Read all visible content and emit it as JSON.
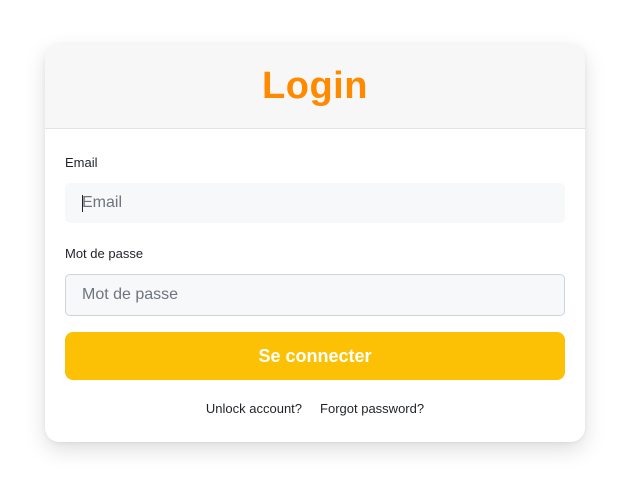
{
  "header": {
    "title": "Login"
  },
  "form": {
    "email_label": "Email",
    "email_placeholder": "Email",
    "email_value": "",
    "password_label": "Mot de passe",
    "password_placeholder": "Mot de passe",
    "password_value": "",
    "submit_label": "Se connecter"
  },
  "links": {
    "unlock": "Unlock account?",
    "forgot": "Forgot password?"
  },
  "colors": {
    "title": "#ff8a00",
    "button": "#fcc105",
    "header_bg": "#f7f7f8"
  }
}
